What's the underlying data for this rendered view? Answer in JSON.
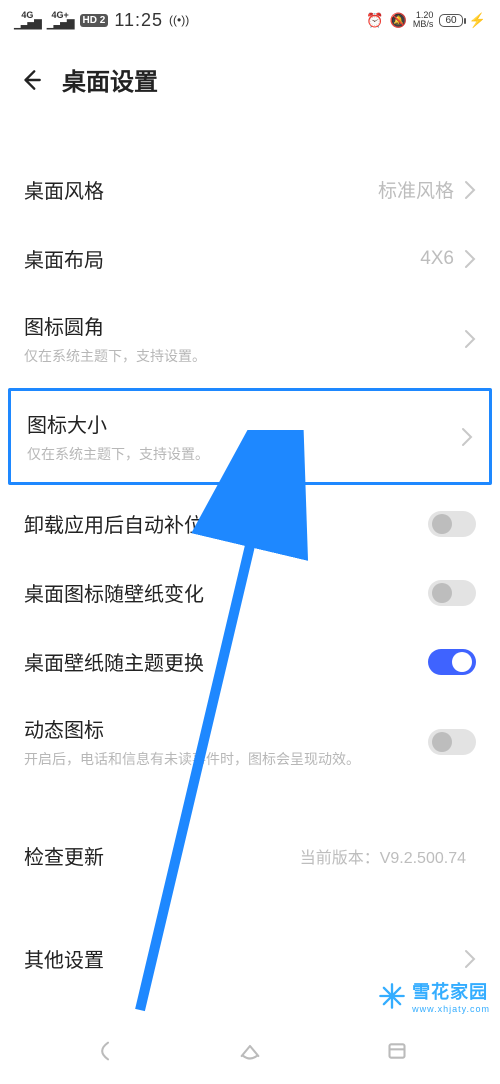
{
  "status": {
    "net1": "4G",
    "net2": "4G+",
    "hd": "HD 2",
    "time": "11:25",
    "speed_num": "1.20",
    "speed_unit": "MB/s",
    "battery": "60"
  },
  "header": {
    "title": "桌面设置"
  },
  "rows": {
    "style": {
      "label": "桌面风格",
      "value": "标准风格"
    },
    "layout": {
      "label": "桌面布局",
      "value": "4X6"
    },
    "corner": {
      "label": "图标圆角",
      "sub": "仅在系统主题下，支持设置。"
    },
    "size": {
      "label": "图标大小",
      "sub": "仅在系统主题下，支持设置。"
    },
    "autofill": {
      "label": "卸载应用后自动补位"
    },
    "iconWall": {
      "label": "桌面图标随壁纸变化"
    },
    "wallTheme": {
      "label": "桌面壁纸随主题更换"
    },
    "dynIcon": {
      "label": "动态图标",
      "sub": "开启后，电话和信息有未读事件时，图标会呈现动效。"
    },
    "update": {
      "label": "检查更新",
      "value": "当前版本：V9.2.500.74"
    },
    "other": {
      "label": "其他设置"
    }
  },
  "toggles": {
    "autofill": false,
    "iconWall": false,
    "wallTheme": true,
    "dynIcon": false
  },
  "watermark": {
    "brand": "雪花家园",
    "site": "www.xhjaty.com"
  }
}
